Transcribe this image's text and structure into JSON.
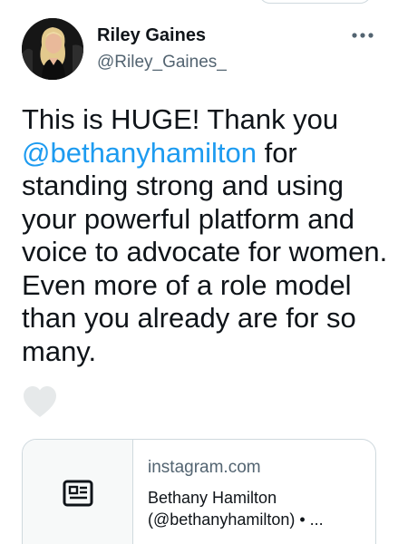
{
  "tweet": {
    "author_name": "Riley Gaines",
    "author_handle": "@Riley_Gaines_",
    "more_label": "•••",
    "text_before": "This is HUGE! Thank you ",
    "mention": "@bethanyhamilton",
    "text_after": " for standing strong and using your powerful platform and voice to advocate for women. Even more of a role model than you already are for so many.",
    "like_icon": "heart-outline-icon"
  },
  "link_card": {
    "thumb_icon": "article-icon",
    "domain": "instagram.com",
    "title_line1": "Bethany Hamilton",
    "title_line2": "(@bethanyhamilton) • ..."
  },
  "colors": {
    "text": "#0f1419",
    "secondary_text": "#536471",
    "link": "#1d9bf0",
    "border": "#cfd9de",
    "heart_fill": "#e6e9ea"
  }
}
